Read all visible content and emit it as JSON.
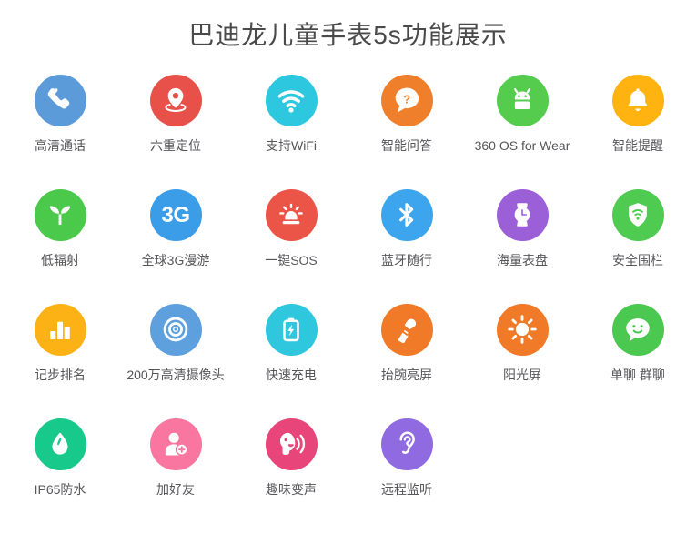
{
  "header": {
    "title": "巴迪龙儿童手表5s功能展示",
    "title_color": "#4a4a4a"
  },
  "palette": {
    "blue": "#5b9bd9",
    "red": "#e8504a",
    "cyan": "#2ec7e0",
    "orange": "#f07f2c",
    "green": "#55cc4d",
    "amber": "#ffb310",
    "green_leaf": "#4bc94a",
    "blue_3g": "#3b9ce8",
    "red_sos": "#ea5548",
    "blue_bt": "#3ca5ee",
    "purple": "#9b5fd8",
    "green_shield": "#4ecb50",
    "amber_chart": "#fcb215",
    "blue_cam": "#5e9fdd",
    "cyan_batt": "#2ec7de",
    "orange_wrist": "#f07a28",
    "orange_sun": "#f07a28",
    "green_chat": "#4ac84f",
    "teal": "#17c98b",
    "pink": "#f8769f",
    "rose": "#e8457a",
    "purple_ear": "#8f6ae0",
    "label_text": "#56565a",
    "background": "#ffffff"
  },
  "features": [
    {
      "label": "高清通话",
      "icon": "phone-icon",
      "color": "#5b9bd9"
    },
    {
      "label": "六重定位",
      "icon": "location-pin-icon",
      "color": "#e8504a"
    },
    {
      "label": "支持WiFi",
      "icon": "wifi-icon",
      "color": "#2ec7e0"
    },
    {
      "label": "智能问答",
      "icon": "question-bubble-icon",
      "color": "#f07f2c"
    },
    {
      "label": "360 OS for Wear",
      "icon": "android-icon",
      "color": "#55cc4d"
    },
    {
      "label": "智能提醒",
      "icon": "bell-icon",
      "color": "#ffb310"
    },
    {
      "label": "低辐射",
      "icon": "sprout-icon",
      "color": "#4bc94a"
    },
    {
      "label": "全球3G漫游",
      "icon": "3g-text-icon",
      "color": "#3b9ce8",
      "glyph": "3G"
    },
    {
      "label": "一键SOS",
      "icon": "siren-alarm-icon",
      "color": "#ea5548"
    },
    {
      "label": "蓝牙随行",
      "icon": "bluetooth-icon",
      "color": "#3ca5ee"
    },
    {
      "label": "海量表盘",
      "icon": "watch-icon",
      "color": "#9b5fd8"
    },
    {
      "label": "安全围栏",
      "icon": "shield-wifi-icon",
      "color": "#4ecb50"
    },
    {
      "label": "记步排名",
      "icon": "bar-chart-icon",
      "color": "#fcb215"
    },
    {
      "label": "200万高清摄像头",
      "icon": "camera-lens-icon",
      "color": "#5e9fdd"
    },
    {
      "label": "快速充电",
      "icon": "battery-bolt-icon",
      "color": "#2ec7de"
    },
    {
      "label": "抬腕亮屏",
      "icon": "raise-wrist-icon",
      "color": "#f07a28"
    },
    {
      "label": "阳光屏",
      "icon": "sun-icon",
      "color": "#f07a28"
    },
    {
      "label": "单聊 群聊",
      "icon": "smiley-chat-icon",
      "color": "#4ac84f"
    },
    {
      "label": "IP65防水",
      "icon": "water-drop-icon",
      "color": "#17c98b"
    },
    {
      "label": "加好友",
      "icon": "add-person-icon",
      "color": "#f8769f"
    },
    {
      "label": "趣味变声",
      "icon": "voice-change-icon",
      "color": "#e8457a"
    },
    {
      "label": "远程监听",
      "icon": "ear-listen-icon",
      "color": "#8f6ae0"
    }
  ]
}
